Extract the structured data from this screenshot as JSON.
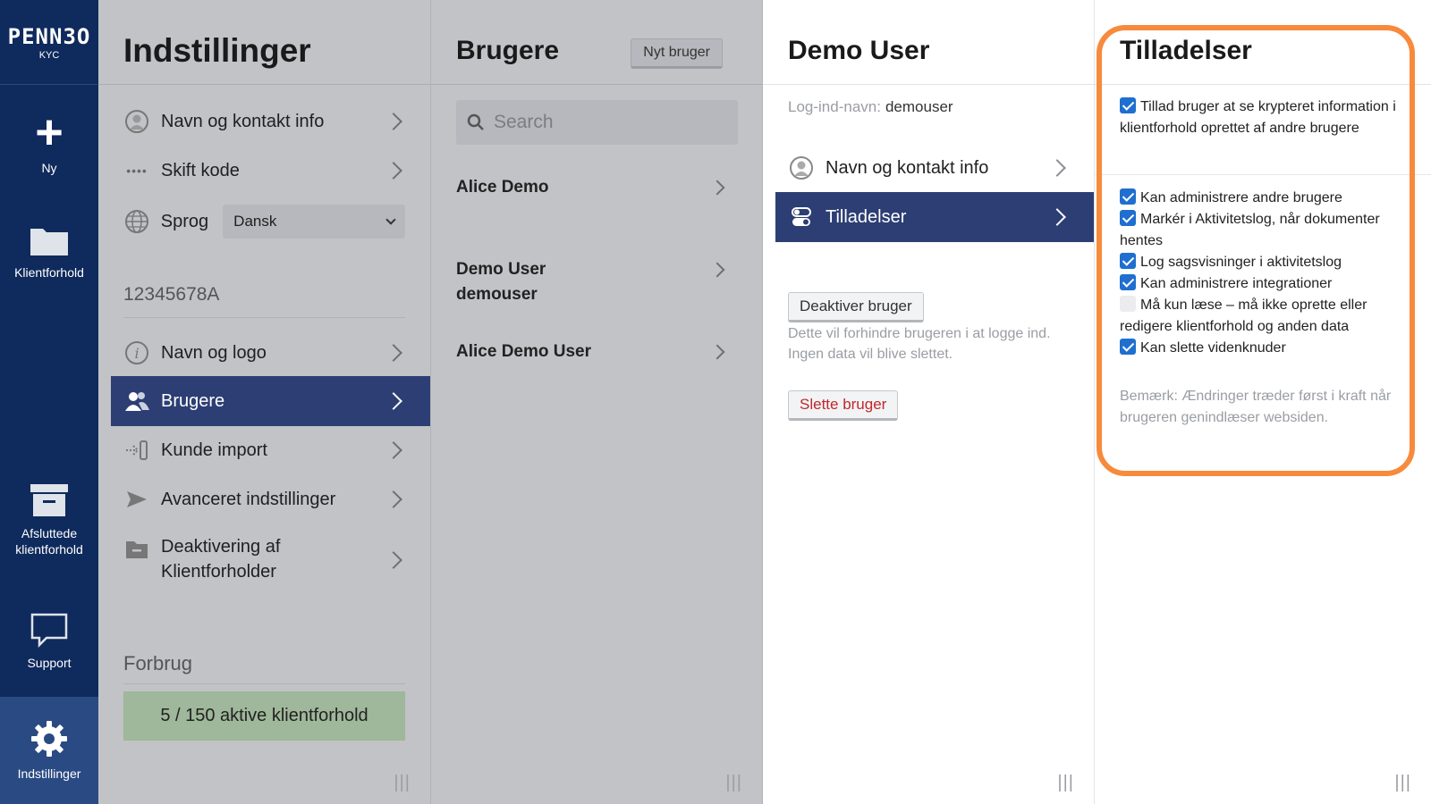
{
  "app": {
    "logo_word": "PENN3O",
    "logo_sub": "KYC"
  },
  "leftnav": {
    "new": "Ny",
    "clients": "Klientforhold",
    "closed": "Afsluttede klientforhold",
    "support": "Support",
    "settings": "Indstillinger"
  },
  "settings_panel": {
    "title": "Indstillinger",
    "items": [
      {
        "label": "Navn og kontakt info"
      },
      {
        "label": "Skift kode"
      },
      {
        "label": "Sprog"
      },
      {
        "label": "Navn og logo"
      },
      {
        "label": "Brugere"
      },
      {
        "label": "Kunde import"
      },
      {
        "label": "Avanceret indstillinger"
      },
      {
        "label": "Deaktivering af Klientforholder"
      }
    ],
    "language_value": "Dansk",
    "company_id": "12345678A",
    "usage_title": "Forbrug",
    "usage_text": "5 / 150 aktive klientforhold"
  },
  "users_panel": {
    "title": "Brugere",
    "new_user_label": "Nyt bruger",
    "search_placeholder": "Search",
    "users": [
      {
        "name": "Alice Demo",
        "login": ""
      },
      {
        "name": "Demo User",
        "login": "demouser"
      },
      {
        "name": "Alice Demo User",
        "login": ""
      }
    ]
  },
  "user_detail": {
    "title": "Demo User",
    "login_label": "Log-ind-navn:",
    "login_value": "demouser",
    "items": [
      {
        "label": "Navn og kontakt info"
      },
      {
        "label": "Tilladelser"
      }
    ],
    "deactivate_label": "Deaktiver bruger",
    "deactivate_help": "Dette vil forhindre brugeren i at logge ind. Ingen data vil blive slettet.",
    "delete_label": "Slette bruger"
  },
  "permissions": {
    "title": "Tilladelser",
    "top": {
      "label": "Tillad bruger at se krypteret information i klientforhold oprettet af andre brugere",
      "checked": true
    },
    "list": [
      {
        "label": "Kan administrere andre brugere",
        "checked": true
      },
      {
        "label": "Markér i Aktivitetslog, når dokumenter hentes",
        "checked": true
      },
      {
        "label": "Log sagsvisninger i aktivitetslog",
        "checked": true
      },
      {
        "label": "Kan administrere integrationer",
        "checked": true
      },
      {
        "label": "Må kun læse – må ikke oprette eller redigere klientforhold og anden data",
        "checked": false
      },
      {
        "label": "Kan slette videnknuder",
        "checked": true
      }
    ],
    "note": "Bemærk: Ændringer træder først i kraft når brugeren genindlæser websiden."
  },
  "colors": {
    "nav_bg": "#0f2a5c",
    "active_row": "#2c3e73",
    "highlight": "#f78a3c",
    "checkbox": "#1f6fcf",
    "usage_box": "#9fb79a",
    "danger": "#c0272d"
  }
}
